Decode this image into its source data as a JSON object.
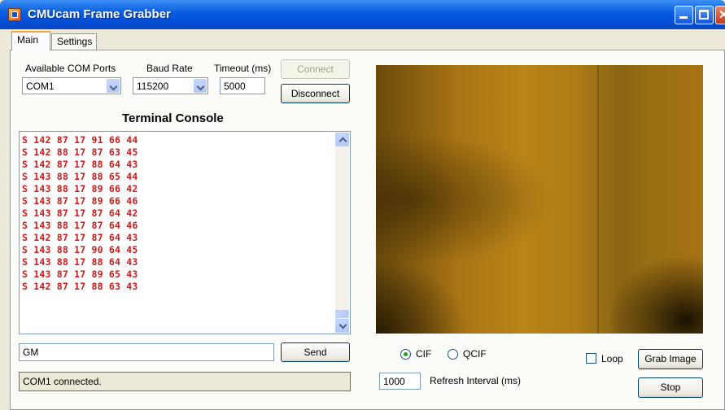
{
  "window": {
    "title": "CMUcam Frame Grabber"
  },
  "tabs": [
    {
      "label": "Main"
    },
    {
      "label": "Settings"
    }
  ],
  "connection": {
    "com_ports_label": "Available COM Ports",
    "com_port_value": "COM1",
    "baud_label": "Baud Rate",
    "baud_value": "115200",
    "timeout_label": "Timeout (ms)",
    "timeout_value": "5000",
    "connect_label": "Connect",
    "disconnect_label": "Disconnect"
  },
  "console": {
    "title": "Terminal Console",
    "lines": [
      "S 142 87 17 91 66 44",
      "S 142 88 17 87 63 45",
      "S 142 87 17 88 64 43",
      "S 143 88 17 88 65 44",
      "S 143 88 17 89 66 42",
      "S 143 87 17 89 66 46",
      "S 143 87 17 87 64 42",
      "S 143 88 17 87 64 46",
      "S 142 87 17 87 64 43",
      "S 143 88 17 90 64 45",
      "S 143 88 17 88 64 43",
      "S 143 87 17 89 65 43",
      "S 142 87 17 88 63 43"
    ],
    "text_color": "#d11a1a"
  },
  "command": {
    "value": "GM",
    "send_label": "Send"
  },
  "status": {
    "text": "COM1 connected."
  },
  "capture": {
    "cif_label": "CIF",
    "qcif_label": "QCIF",
    "selected_format": "CIF",
    "loop_label": "Loop",
    "loop_checked": false,
    "grab_label": "Grab Image",
    "refresh_value": "1000",
    "refresh_label": "Refresh Interval (ms)",
    "stop_label": "Stop"
  }
}
